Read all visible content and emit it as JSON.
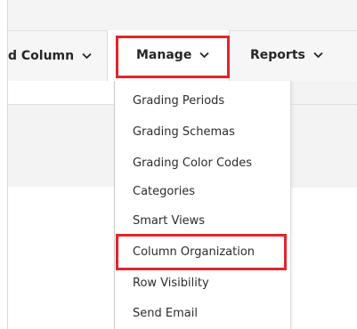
{
  "toolbar": {
    "add_column_label": "d Column",
    "manage_label": "Manage",
    "reports_label": "Reports"
  },
  "manage_menu": {
    "items": [
      "Grading Periods",
      "Grading Schemas",
      "Grading Color Codes",
      "Categories",
      "Smart Views",
      "Column Organization",
      "Row Visibility",
      "Send Email"
    ]
  },
  "icons": {
    "dropdown": "chevron-down-icon"
  },
  "colors": {
    "highlight": "#e3242b",
    "text": "#262626"
  }
}
